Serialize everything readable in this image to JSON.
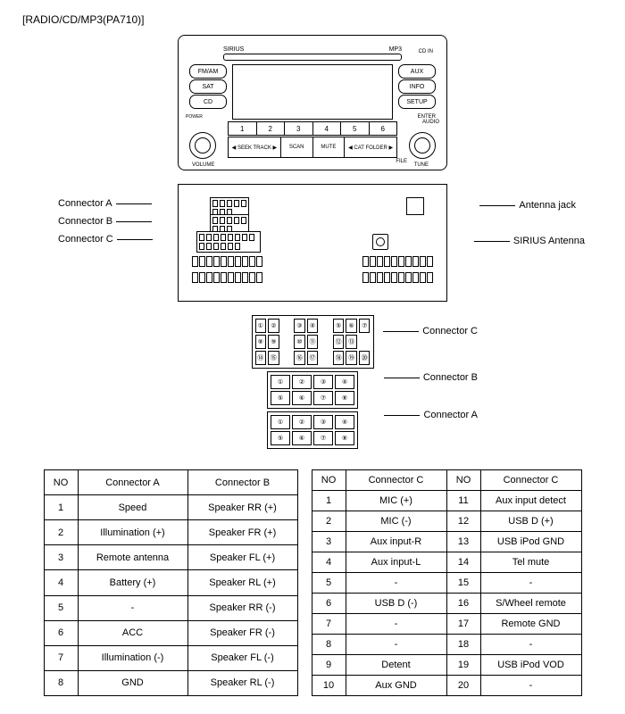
{
  "title": "[RADIO/CD/MP3(PA710)]",
  "face": {
    "sirius": "SIRIUS",
    "mp3": "MP3",
    "cdin": "CD IN",
    "left": [
      "FM/AM",
      "SAT",
      "CD"
    ],
    "right": [
      "AUX",
      "INFO",
      "SETUP"
    ],
    "power": "POWER",
    "volume": "VOLUME",
    "enter": "ENTER",
    "audio": "AUDIO",
    "file": "FILE",
    "tune": "TUNE",
    "presets": [
      "1",
      "2",
      "3",
      "4",
      "5",
      "6"
    ],
    "bottom": [
      "◀ SEEK TRACK ▶",
      "SCAN",
      "MUTE",
      "◀ CAT FOLDER ▶"
    ]
  },
  "rear": {
    "connA": "Connector A",
    "connB": "Connector B",
    "connC": "Connector C",
    "ant": "Antenna jack",
    "sir": "SIRIUS Antenna"
  },
  "pinout": {
    "connA": "Connector A",
    "connB": "Connector B",
    "connC": "Connector C",
    "c_top": [
      "①",
      "②",
      "③",
      "④",
      "⑤",
      "⑥",
      "⑦",
      "⑧",
      "⑨",
      "⑩",
      "⑪",
      "⑫",
      "⑬",
      "⑭",
      "⑮",
      "⑯",
      "⑰",
      "⑱",
      "⑲",
      "⑳"
    ],
    "b": [
      "①",
      "②",
      "③",
      "④",
      "⑤",
      "⑥",
      "⑦",
      "⑧"
    ],
    "a": [
      "①",
      "②",
      "③",
      "④",
      "⑤",
      "⑥",
      "⑦",
      "⑧"
    ]
  },
  "table1": {
    "headers": [
      "NO",
      "Connector A",
      "Connector B"
    ],
    "rows": [
      [
        "1",
        "Speed",
        "Speaker RR (+)"
      ],
      [
        "2",
        "Illumination (+)",
        "Speaker FR (+)"
      ],
      [
        "3",
        "Remote antenna",
        "Speaker FL (+)"
      ],
      [
        "4",
        "Battery (+)",
        "Speaker RL (+)"
      ],
      [
        "5",
        "-",
        "Speaker RR (-)"
      ],
      [
        "6",
        "ACC",
        "Speaker FR (-)"
      ],
      [
        "7",
        "Illumination (-)",
        "Speaker FL (-)"
      ],
      [
        "8",
        "GND",
        "Speaker RL (-)"
      ]
    ]
  },
  "table2": {
    "headers": [
      "NO",
      "Connector C",
      "NO",
      "Connector C"
    ],
    "rows": [
      [
        "1",
        "MIC (+)",
        "11",
        "Aux input detect"
      ],
      [
        "2",
        "MIC (-)",
        "12",
        "USB D (+)"
      ],
      [
        "3",
        "Aux input-R",
        "13",
        "USB iPod GND"
      ],
      [
        "4",
        "Aux input-L",
        "14",
        "Tel mute"
      ],
      [
        "5",
        "-",
        "15",
        "-"
      ],
      [
        "6",
        "USB D (-)",
        "16",
        "S/Wheel remote"
      ],
      [
        "7",
        "-",
        "17",
        "Remote GND"
      ],
      [
        "8",
        "-",
        "18",
        "-"
      ],
      [
        "9",
        "Detent",
        "19",
        "USB iPod VOD"
      ],
      [
        "10",
        "Aux GND",
        "20",
        "-"
      ]
    ]
  }
}
